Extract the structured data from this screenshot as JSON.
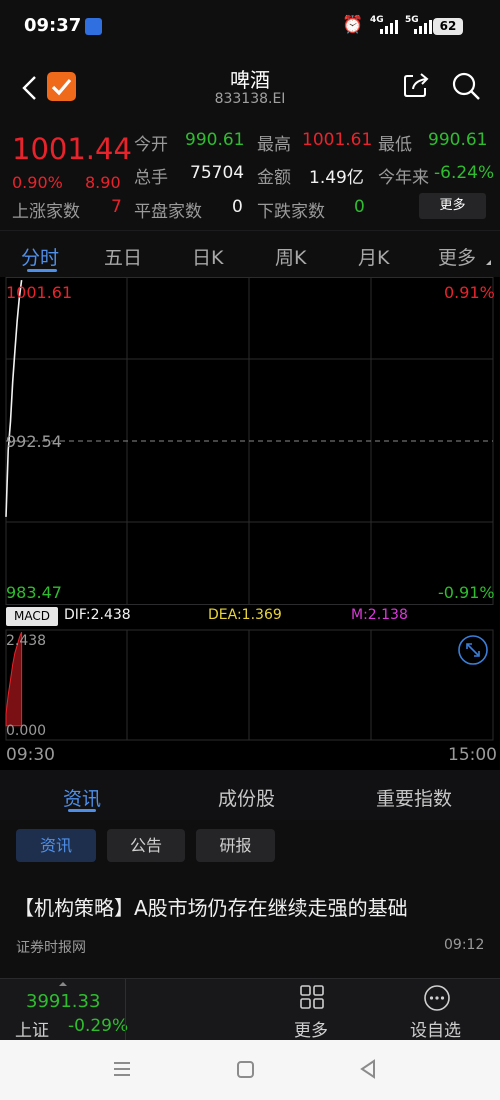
{
  "status_bar": {
    "time": "09:37",
    "net1": "4G",
    "net2": "5G",
    "battery": "62"
  },
  "header": {
    "title": "啤酒",
    "code": "833138.EI"
  },
  "quote": {
    "price": "1001.44",
    "change_pct": "0.90%",
    "change_val": "8.90",
    "open_label": "今开",
    "open": "990.61",
    "high_label": "最高",
    "high": "1001.61",
    "low_label": "最低",
    "low": "990.61",
    "volume_label": "总手",
    "volume": "75704",
    "amount_label": "金额",
    "amount": "1.49亿",
    "ytd_label": "今年来",
    "ytd": "-6.24%",
    "up_label": "上涨家数",
    "up": "7",
    "flat_label": "平盘家数",
    "flat": "0",
    "down_label": "下跌家数",
    "down": "0",
    "more_button": "更多"
  },
  "period_tabs": [
    "分时",
    "五日",
    "日K",
    "周K",
    "月K",
    "更多"
  ],
  "chart": {
    "y_max": "1001.61",
    "y_mid": "992.54",
    "y_min": "983.47",
    "pct_max": "0.91%",
    "pct_min": "-0.91%",
    "macd_badge": "MACD",
    "dif": "DIF:2.438",
    "dea": "DEA:1.369",
    "m": "M:2.138",
    "macd_top": "2.438",
    "macd_zero": "0.000",
    "time_start": "09:30",
    "time_end": "15:00"
  },
  "chart_data": {
    "type": "line",
    "title": "",
    "x": [
      "09:30",
      "09:31",
      "09:32",
      "09:33",
      "09:34",
      "09:35",
      "09:36",
      "09:37"
    ],
    "y": [
      988.3,
      992.0,
      993.6,
      995.8,
      997.5,
      999.2,
      1000.5,
      1001.44
    ],
    "ylim": [
      983.47,
      1001.61
    ],
    "reference_line": 992.54,
    "xlabel": "",
    "ylabel": "",
    "grid": true,
    "macd": {
      "x": [
        "09:30",
        "09:31",
        "09:32",
        "09:33",
        "09:34",
        "09:35",
        "09:36",
        "09:37"
      ],
      "bar": [
        0.3,
        0.8,
        1.2,
        1.6,
        1.9,
        2.1,
        2.3,
        2.44
      ],
      "ylim": [
        0,
        2.438
      ]
    }
  },
  "news_tabs": [
    "资讯",
    "成份股",
    "重要指数"
  ],
  "sub_tabs": [
    "资讯",
    "公告",
    "研报"
  ],
  "article": {
    "title": "【机构策略】A股市场仍存在继续走强的基础",
    "source": "证券时报网",
    "time": "09:12"
  },
  "bottom_bar": {
    "index_value": "3991.33",
    "index_name": "上证",
    "index_change": "-0.29%",
    "more": "更多",
    "watchlist": "设自选"
  },
  "colors": {
    "up": "#e8232b",
    "down": "#2fbd2f",
    "accent": "#4f8fe8",
    "background": "#000000"
  }
}
